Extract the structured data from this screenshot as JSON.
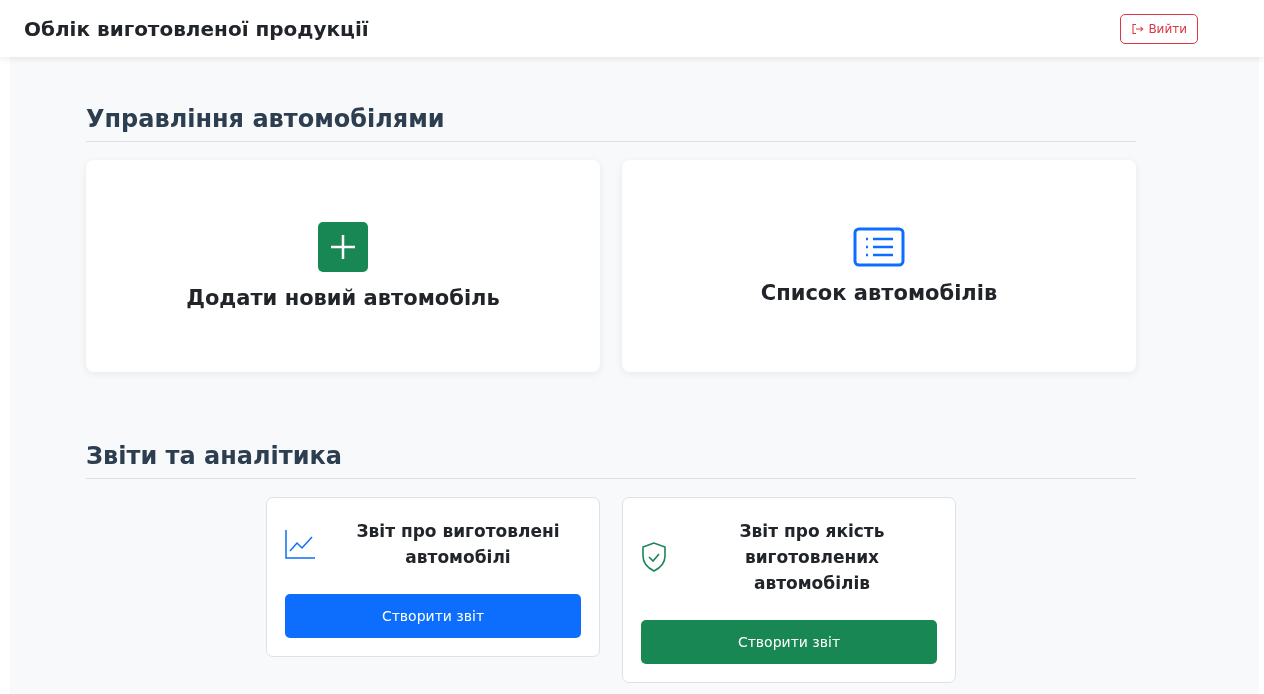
{
  "header": {
    "title": "Облік виготовленої продукції",
    "logout_button": "Вийти"
  },
  "sections": [
    {
      "title": "Управління автомобілями",
      "kind": "tiles",
      "items": [
        {
          "label": "Додати новий автомобіль"
        },
        {
          "label": "Список автомобілів"
        }
      ]
    },
    {
      "title": "Звіти та аналітика",
      "kind": "reports",
      "items": [
        {
          "label": "Звіт про виготовлені автомобілі",
          "button": "Створити звіт"
        },
        {
          "label": "Звіт про якість виготовлених автомобілів",
          "button": "Створити звіт"
        }
      ]
    }
  ]
}
